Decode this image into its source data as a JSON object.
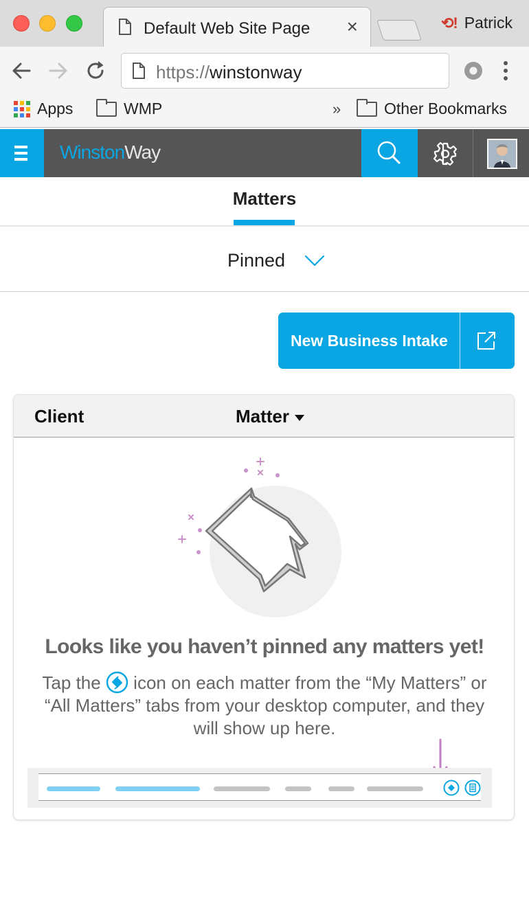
{
  "browser": {
    "tab_title": "Default Web Site Page",
    "profile_name": "Patrick",
    "url_scheme": "https://",
    "url_host": "winstonway",
    "bookmarks": {
      "apps": "Apps",
      "wmp": "WMP",
      "overflow": "»",
      "other": "Other Bookmarks"
    }
  },
  "app": {
    "brand_part1": "Winston",
    "brand_part2": "Way",
    "accent_color": "#0aa6e3",
    "header_color": "#555555"
  },
  "tabs": {
    "active": "Matters"
  },
  "filter": {
    "selected": "Pinned"
  },
  "actions": {
    "new_business_intake": "New Business Intake"
  },
  "table": {
    "columns": [
      "Client",
      "Matter"
    ]
  },
  "empty_state": {
    "title": "Looks like you haven’t pinned any matters yet!",
    "desc_before": "Tap the ",
    "desc_after": " icon on each matter from the “My Matters” or “All Matters” tabs from your desktop computer, and they will show up here."
  }
}
